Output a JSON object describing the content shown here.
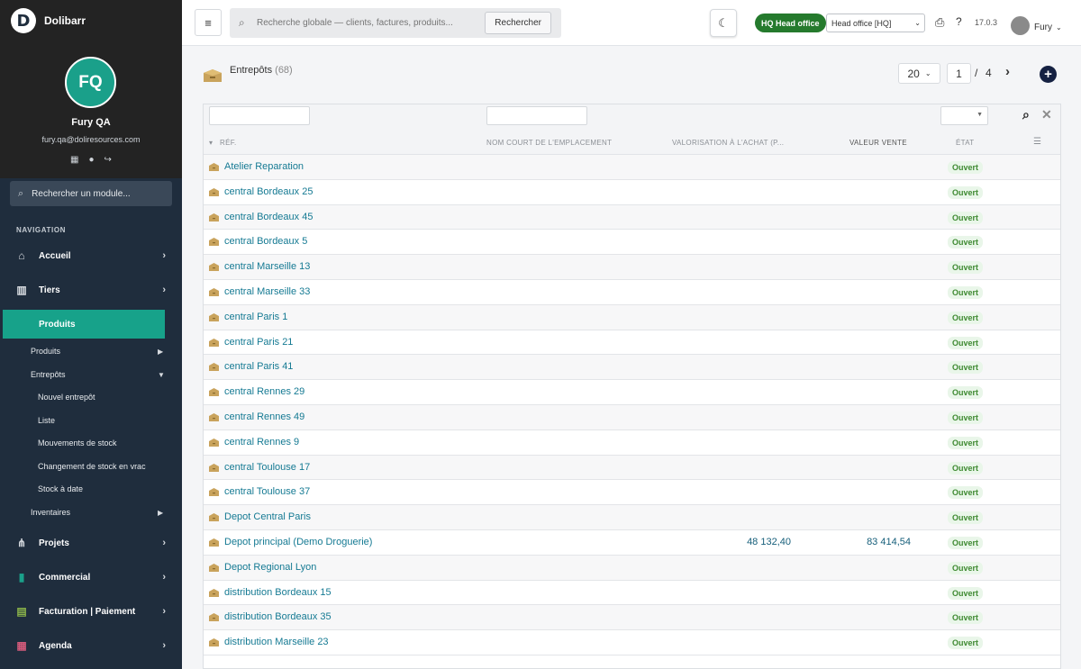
{
  "app": {
    "name": "Dolibarr",
    "logo_letter": "D"
  },
  "user": {
    "initials": "FQ",
    "name": "Fury QA",
    "email": "fury.qa@doliresources.com",
    "short_name": "Fury"
  },
  "sidebar": {
    "search_placeholder": "Rechercher un module...",
    "nav_heading": "NAVIGATION",
    "items": [
      {
        "label": "Accueil",
        "icon": "home-icon"
      },
      {
        "label": "Tiers",
        "icon": "building-icon"
      },
      {
        "label": "Produits",
        "icon": "box-icon",
        "active": true
      },
      {
        "label": "Projets",
        "icon": "sitemap-icon"
      },
      {
        "label": "Commercial",
        "icon": "briefcase-icon"
      },
      {
        "label": "Facturation | Paiement",
        "icon": "invoice-icon"
      },
      {
        "label": "Agenda",
        "icon": "calendar-icon"
      }
    ],
    "sub_items": [
      {
        "label": "Produits"
      },
      {
        "label": "Entrepôts"
      },
      {
        "label": "Nouvel entrepôt"
      },
      {
        "label": "Liste"
      },
      {
        "label": "Mouvements de stock"
      },
      {
        "label": "Changement de stock en vrac"
      },
      {
        "label": "Stock à date"
      },
      {
        "label": "Inventaires"
      }
    ]
  },
  "topbar": {
    "search_placeholder": "Recherche globale — clients, factures, produits...",
    "search_button": "Rechercher",
    "entity_badge": "HQ Head office",
    "entity_select": "Head office [HQ]",
    "version": "17.0.3"
  },
  "page": {
    "title": "Entrepôts",
    "count": "(68)",
    "page_size": "20",
    "current_page": "1",
    "page_sep": "/",
    "total_pages": "4"
  },
  "table": {
    "headers": {
      "ref": "RÉF.",
      "location": "NOM COURT DE L'EMPLACEMENT",
      "purchase_value": "VALORISATION À L'ACHAT (P...",
      "sale_value": "VALEUR VENTE",
      "status": "ÉTAT"
    },
    "rows": [
      {
        "ref": "Atelier Reparation",
        "purchase": "",
        "sale": "",
        "status": "Ouvert"
      },
      {
        "ref": "central Bordeaux 25",
        "purchase": "",
        "sale": "",
        "status": "Ouvert"
      },
      {
        "ref": "central Bordeaux 45",
        "purchase": "",
        "sale": "",
        "status": "Ouvert"
      },
      {
        "ref": "central Bordeaux 5",
        "purchase": "",
        "sale": "",
        "status": "Ouvert"
      },
      {
        "ref": "central Marseille 13",
        "purchase": "",
        "sale": "",
        "status": "Ouvert"
      },
      {
        "ref": "central Marseille 33",
        "purchase": "",
        "sale": "",
        "status": "Ouvert"
      },
      {
        "ref": "central Paris 1",
        "purchase": "",
        "sale": "",
        "status": "Ouvert"
      },
      {
        "ref": "central Paris 21",
        "purchase": "",
        "sale": "",
        "status": "Ouvert"
      },
      {
        "ref": "central Paris 41",
        "purchase": "",
        "sale": "",
        "status": "Ouvert"
      },
      {
        "ref": "central Rennes 29",
        "purchase": "",
        "sale": "",
        "status": "Ouvert"
      },
      {
        "ref": "central Rennes 49",
        "purchase": "",
        "sale": "",
        "status": "Ouvert"
      },
      {
        "ref": "central Rennes 9",
        "purchase": "",
        "sale": "",
        "status": "Ouvert"
      },
      {
        "ref": "central Toulouse 17",
        "purchase": "",
        "sale": "",
        "status": "Ouvert"
      },
      {
        "ref": "central Toulouse 37",
        "purchase": "",
        "sale": "",
        "status": "Ouvert"
      },
      {
        "ref": "Depot Central Paris",
        "purchase": "",
        "sale": "",
        "status": "Ouvert"
      },
      {
        "ref": "Depot principal (Demo Droguerie)",
        "purchase": "48 132,40",
        "sale": "83 414,54",
        "status": "Ouvert"
      },
      {
        "ref": "Depot Regional Lyon",
        "purchase": "",
        "sale": "",
        "status": "Ouvert"
      },
      {
        "ref": "distribution Bordeaux 15",
        "purchase": "",
        "sale": "",
        "status": "Ouvert"
      },
      {
        "ref": "distribution Bordeaux 35",
        "purchase": "",
        "sale": "",
        "status": "Ouvert"
      },
      {
        "ref": "distribution Marseille 23",
        "purchase": "",
        "sale": "",
        "status": "Ouvert"
      }
    ]
  },
  "colors": {
    "sidebar_bg": "#1f2d3d",
    "sidebar_active": "#17a28a",
    "link": "#157a93",
    "status_open": "#3f8a32",
    "badge_green": "#257a2d"
  }
}
